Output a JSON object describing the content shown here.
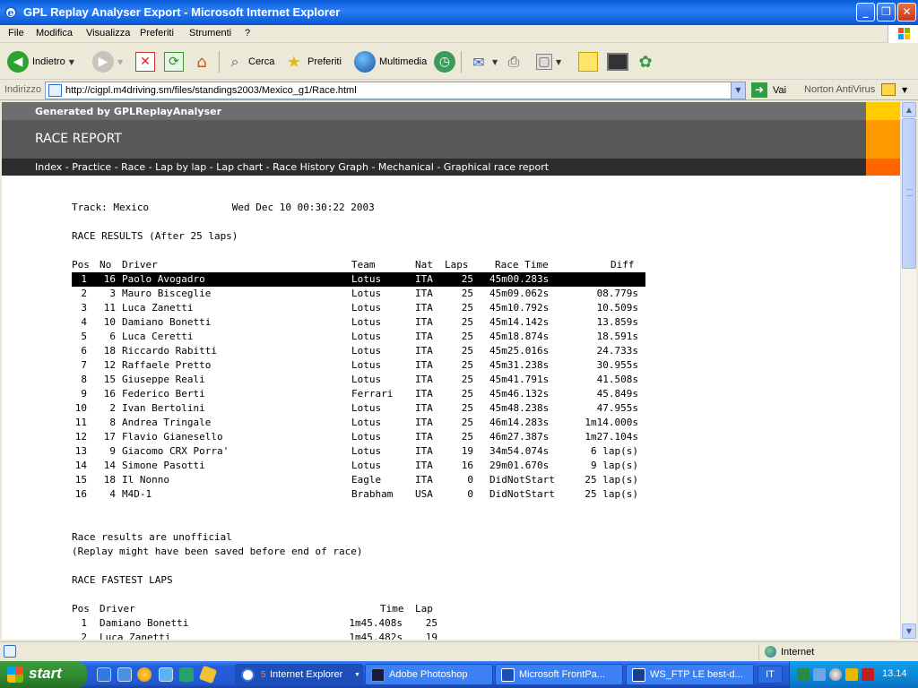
{
  "window": {
    "title": "GPL Replay Analyser Export - Microsoft Internet Explorer",
    "controls": {
      "minimize": "_",
      "maximize": "❐",
      "close": "✕"
    }
  },
  "menu": {
    "items": [
      "File",
      "Modifica",
      "Visualizza",
      "Preferiti",
      "Strumenti",
      "?"
    ]
  },
  "toolbar": {
    "back_label": "Indietro",
    "search_label": "Cerca",
    "favorites_label": "Preferiti",
    "media_label": "Multimedia"
  },
  "address": {
    "label": "Indirizzo",
    "url": "http://cigpl.m4driving.sm/files/standings2003/Mexico_g1/Race.html",
    "go_label": "Vai",
    "norton_label": "Norton AntiVirus"
  },
  "page": {
    "generated_by": "Generated by GPLReplayAnalyser",
    "report_title": "RACE REPORT",
    "nav": [
      "Index",
      "Practice",
      "Race",
      "Lap by lap",
      "Lap chart",
      "Race History Graph",
      "Mechanical",
      "Graphical race report"
    ],
    "track_line": "Track: Mexico              Wed Dec 10 00:30:22 2003",
    "results_heading": "RACE RESULTS (After 25 laps)",
    "results_headers": {
      "pos": "Pos",
      "no": "No",
      "driver": "Driver",
      "team": "Team",
      "nat": "Nat",
      "laps": "Laps",
      "time": "Race Time",
      "diff": "Diff"
    },
    "results": [
      {
        "pos": "1",
        "no": "16",
        "driver": "Paolo Avogadro",
        "team": "Lotus",
        "nat": "ITA",
        "laps": "25",
        "time": "45m00.283s",
        "diff": ""
      },
      {
        "pos": "2",
        "no": "3",
        "driver": "Mauro Bisceglie",
        "team": "Lotus",
        "nat": "ITA",
        "laps": "25",
        "time": "45m09.062s",
        "diff": "08.779s"
      },
      {
        "pos": "3",
        "no": "11",
        "driver": "Luca Zanetti",
        "team": "Lotus",
        "nat": "ITA",
        "laps": "25",
        "time": "45m10.792s",
        "diff": "10.509s"
      },
      {
        "pos": "4",
        "no": "10",
        "driver": "Damiano Bonetti",
        "team": "Lotus",
        "nat": "ITA",
        "laps": "25",
        "time": "45m14.142s",
        "diff": "13.859s"
      },
      {
        "pos": "5",
        "no": "6",
        "driver": "Luca Ceretti",
        "team": "Lotus",
        "nat": "ITA",
        "laps": "25",
        "time": "45m18.874s",
        "diff": "18.591s"
      },
      {
        "pos": "6",
        "no": "18",
        "driver": "Riccardo Rabitti",
        "team": "Lotus",
        "nat": "ITA",
        "laps": "25",
        "time": "45m25.016s",
        "diff": "24.733s"
      },
      {
        "pos": "7",
        "no": "12",
        "driver": "Raffaele Pretto",
        "team": "Lotus",
        "nat": "ITA",
        "laps": "25",
        "time": "45m31.238s",
        "diff": "30.955s"
      },
      {
        "pos": "8",
        "no": "15",
        "driver": "Giuseppe Reali",
        "team": "Lotus",
        "nat": "ITA",
        "laps": "25",
        "time": "45m41.791s",
        "diff": "41.508s"
      },
      {
        "pos": "9",
        "no": "16",
        "driver": "Federico Berti",
        "team": "Ferrari",
        "nat": "ITA",
        "laps": "25",
        "time": "45m46.132s",
        "diff": "45.849s"
      },
      {
        "pos": "10",
        "no": "2",
        "driver": "Ivan Bertolini",
        "team": "Lotus",
        "nat": "ITA",
        "laps": "25",
        "time": "45m48.238s",
        "diff": "47.955s"
      },
      {
        "pos": "11",
        "no": "8",
        "driver": "Andrea Tringale",
        "team": "Lotus",
        "nat": "ITA",
        "laps": "25",
        "time": "46m14.283s",
        "diff": "1m14.000s"
      },
      {
        "pos": "12",
        "no": "17",
        "driver": "Flavio Gianesello",
        "team": "Lotus",
        "nat": "ITA",
        "laps": "25",
        "time": "46m27.387s",
        "diff": "1m27.104s"
      },
      {
        "pos": "13",
        "no": "9",
        "driver": "Giacomo CRX Porra'",
        "team": "Lotus",
        "nat": "ITA",
        "laps": "19",
        "time": "34m54.074s",
        "diff": "6 lap(s)"
      },
      {
        "pos": "14",
        "no": "14",
        "driver": "Simone Pasotti",
        "team": "Lotus",
        "nat": "ITA",
        "laps": "16",
        "time": "29m01.670s",
        "diff": "9 lap(s)"
      },
      {
        "pos": "15",
        "no": "18",
        "driver": "Il Nonno",
        "team": "Eagle",
        "nat": "ITA",
        "laps": "0",
        "time": "DidNotStart",
        "diff": "25 lap(s)"
      },
      {
        "pos": "16",
        "no": "4",
        "driver": "M4D-1",
        "team": "Brabham",
        "nat": "USA",
        "laps": "0",
        "time": "DidNotStart",
        "diff": "25 lap(s)"
      }
    ],
    "unofficial_1": "Race results are unofficial",
    "unofficial_2": "(Replay might have been saved before end of race)",
    "fastest_heading": "RACE FASTEST LAPS",
    "fastest_headers": {
      "pos": "Pos",
      "driver": "Driver",
      "time": "Time",
      "lap": "Lap"
    },
    "fastest": [
      {
        "pos": "1",
        "driver": "Damiano Bonetti",
        "time": "1m45.408s",
        "lap": "25"
      },
      {
        "pos": "2",
        "driver": "Luca Zanetti",
        "time": "1m45.482s",
        "lap": "19"
      }
    ]
  },
  "status": {
    "zone": "Internet"
  },
  "taskbar": {
    "start": "start",
    "tasks": [
      "Internet Explorer",
      "Adobe Photoshop",
      "Microsoft FrontPa...",
      "WS_FTP LE best-d..."
    ],
    "task_counts": [
      "5"
    ],
    "language": "IT",
    "clock": "13.14"
  },
  "colors": {
    "accent_yellow": "#ffcc00",
    "accent_orange": "#ff9900",
    "accent_red": "#ff6600",
    "header_gray": "#585858"
  }
}
